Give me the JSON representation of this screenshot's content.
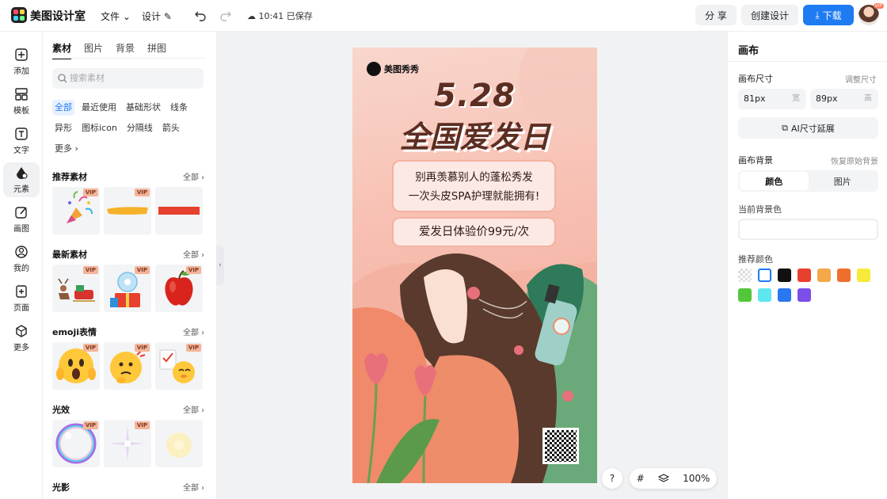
{
  "app": {
    "title": "美图设计室"
  },
  "topbar": {
    "menu_file": "文件",
    "menu_design": "设计",
    "save_status": "10:41 已保存",
    "share": "分 享",
    "create": "创建设计",
    "download": "下载",
    "avatar_badge": "VIP"
  },
  "rail": [
    {
      "label": "添加",
      "icon": "add-icon"
    },
    {
      "label": "模板",
      "icon": "template-icon"
    },
    {
      "label": "文字",
      "icon": "text-icon"
    },
    {
      "label": "元素",
      "icon": "element-icon"
    },
    {
      "label": "画图",
      "icon": "draw-icon"
    },
    {
      "label": "我的",
      "icon": "user-icon"
    },
    {
      "label": "页面",
      "icon": "page-icon"
    },
    {
      "label": "更多",
      "icon": "more-icon"
    }
  ],
  "panel": {
    "tabs": [
      "素材",
      "图片",
      "背景",
      "拼图"
    ],
    "search_placeholder": "搜索素材",
    "chips": [
      "全部",
      "最近使用",
      "基础形状",
      "线条",
      "异形",
      "图标icon",
      "分隔线",
      "箭头",
      "更多"
    ],
    "see_all": "全部",
    "vip": "VIP",
    "sections": [
      {
        "title": "推荐素材"
      },
      {
        "title": "最新素材"
      },
      {
        "title": "emoji表情"
      },
      {
        "title": "光效"
      },
      {
        "title": "光影"
      }
    ]
  },
  "poster": {
    "brand": "美图秀秀",
    "date": "5.28",
    "headline": "全国爱发日",
    "line1": "别再羡慕别人的蓬松秀发",
    "line2": "一次头皮SPA护理就能拥有!",
    "price": "爱发日体验价99元/次"
  },
  "canvas_controls": {
    "help": "?",
    "zoom": "100%"
  },
  "right": {
    "header": "画布",
    "size_label": "画布尺寸",
    "resize_link": "调整尺寸",
    "width_value": "81px",
    "width_unit": "宽",
    "height_value": "89px",
    "height_unit": "高",
    "ai_extend": "AI尺寸延展",
    "bg_label": "画布背景",
    "restore_link": "恢复原始背景",
    "seg_color": "颜色",
    "seg_image": "图片",
    "current_bg": "当前背景色",
    "recommend": "推荐颜色",
    "swatches": [
      "transparent",
      "#ffffff",
      "#111111",
      "#e8402e",
      "#f4a84a",
      "#ee6f2d",
      "#f6ea3a",
      "#52c73b",
      "#5ee7f0",
      "#2878f0",
      "#7b4fe8"
    ]
  },
  "colors": {
    "accent": "#1e7bf2",
    "poster_text": "#5c2e22"
  }
}
